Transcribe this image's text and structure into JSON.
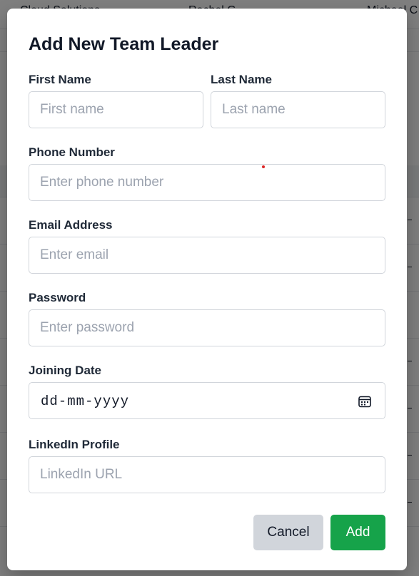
{
  "background": {
    "header_cells": [
      "Cloud Solutions",
      "Rachel G",
      "Michael C"
    ]
  },
  "modal": {
    "title": "Add New Team Leader",
    "first_name": {
      "label": "First Name",
      "placeholder": "First name",
      "value": ""
    },
    "last_name": {
      "label": "Last Name",
      "placeholder": "Last name",
      "value": ""
    },
    "phone": {
      "label": "Phone Number",
      "placeholder": "Enter phone number",
      "value": ""
    },
    "email": {
      "label": "Email Address",
      "placeholder": "Enter email",
      "value": ""
    },
    "password": {
      "label": "Password",
      "placeholder": "Enter password",
      "value": ""
    },
    "joining_date": {
      "label": "Joining Date",
      "value": "dd-mm-yyyy",
      "icon": "calendar-icon"
    },
    "linkedin": {
      "label": "LinkedIn Profile",
      "placeholder": "LinkedIn URL",
      "value": ""
    },
    "cancel_label": "Cancel",
    "add_label": "Add"
  },
  "colors": {
    "add_button": "#16a34a",
    "cancel_button": "#d1d5db",
    "overlay": "rgba(0,0,0,0.5)"
  }
}
